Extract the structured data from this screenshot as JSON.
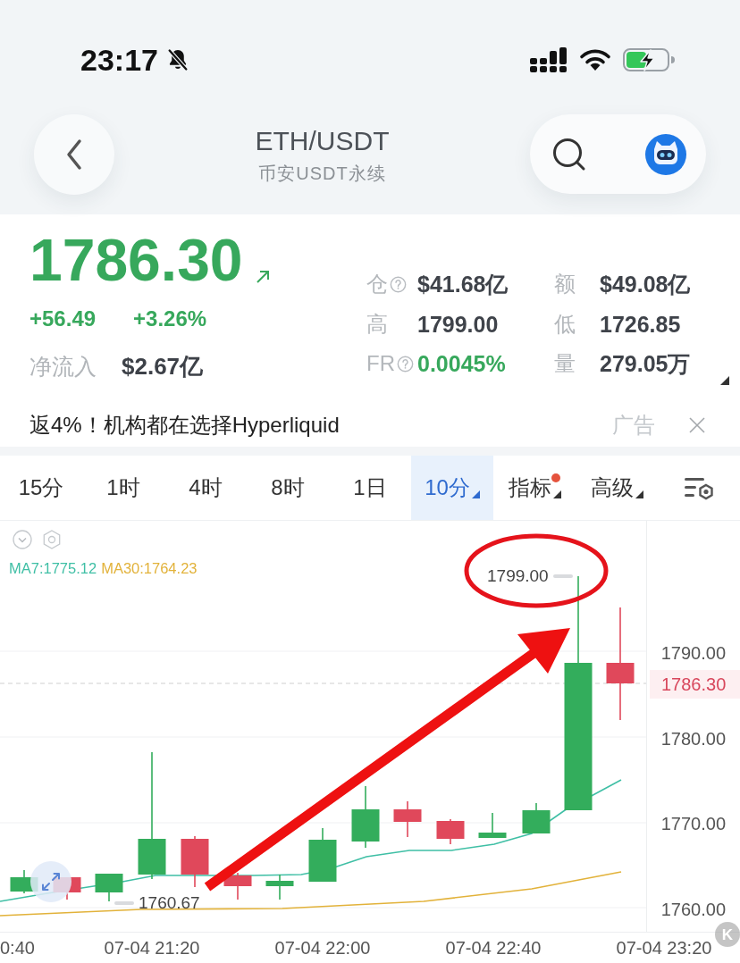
{
  "status_bar": {
    "time": "23:17"
  },
  "header": {
    "title": "ETH/USDT",
    "subtitle": "币安USDT永续"
  },
  "quote": {
    "price": "1786.30",
    "rising": true,
    "change": "+56.49",
    "change_percent": "+3.26%",
    "net_inflow_label": "净流入",
    "net_inflow_value": "$2.67亿"
  },
  "stats": [
    {
      "label": "仓",
      "help": true,
      "value": "$41.68亿",
      "positive": false
    },
    {
      "label": "额",
      "help": false,
      "value": "$49.08亿",
      "positive": false
    },
    {
      "label": "高",
      "help": false,
      "value": "1799.00",
      "positive": false
    },
    {
      "label": "低",
      "help": false,
      "value": "1726.85",
      "positive": false
    },
    {
      "label": "FR",
      "help": true,
      "value": "0.0045%",
      "positive": true
    },
    {
      "label": "量",
      "help": false,
      "value": "279.05万",
      "positive": false
    }
  ],
  "ad": {
    "text": "返4%！机构都在选择Hyperliquid",
    "tag": "广告"
  },
  "tabs": [
    {
      "label": "15分",
      "selected": false,
      "menu": false,
      "alert": false
    },
    {
      "label": "1时",
      "selected": false,
      "menu": false,
      "alert": false
    },
    {
      "label": "4时",
      "selected": false,
      "menu": false,
      "alert": false
    },
    {
      "label": "8时",
      "selected": false,
      "menu": false,
      "alert": false
    },
    {
      "label": "1日",
      "selected": false,
      "menu": false,
      "alert": false
    },
    {
      "label": "10分",
      "selected": true,
      "menu": true,
      "alert": false
    },
    {
      "label": "指标",
      "selected": false,
      "menu": true,
      "alert": true
    },
    {
      "label": "高级",
      "selected": false,
      "menu": true,
      "alert": false
    }
  ],
  "chart": {
    "legend": [
      {
        "label": "MA7:1775.12",
        "color": "#3fbfa5"
      },
      {
        "label": "MA30:1764.23",
        "color": "#e2b23a"
      }
    ],
    "high_label": "1799.00",
    "low_label": "1760.67",
    "price_labels": [
      "1790.00",
      "1780.00",
      "1770.00",
      "1760.00"
    ],
    "current_price": "1786.30",
    "time_labels": [
      "0:40",
      "07-04 21:20",
      "07-04 22:00",
      "07-04 22:40",
      "07-04 23:20"
    ],
    "badge": "K"
  }
}
